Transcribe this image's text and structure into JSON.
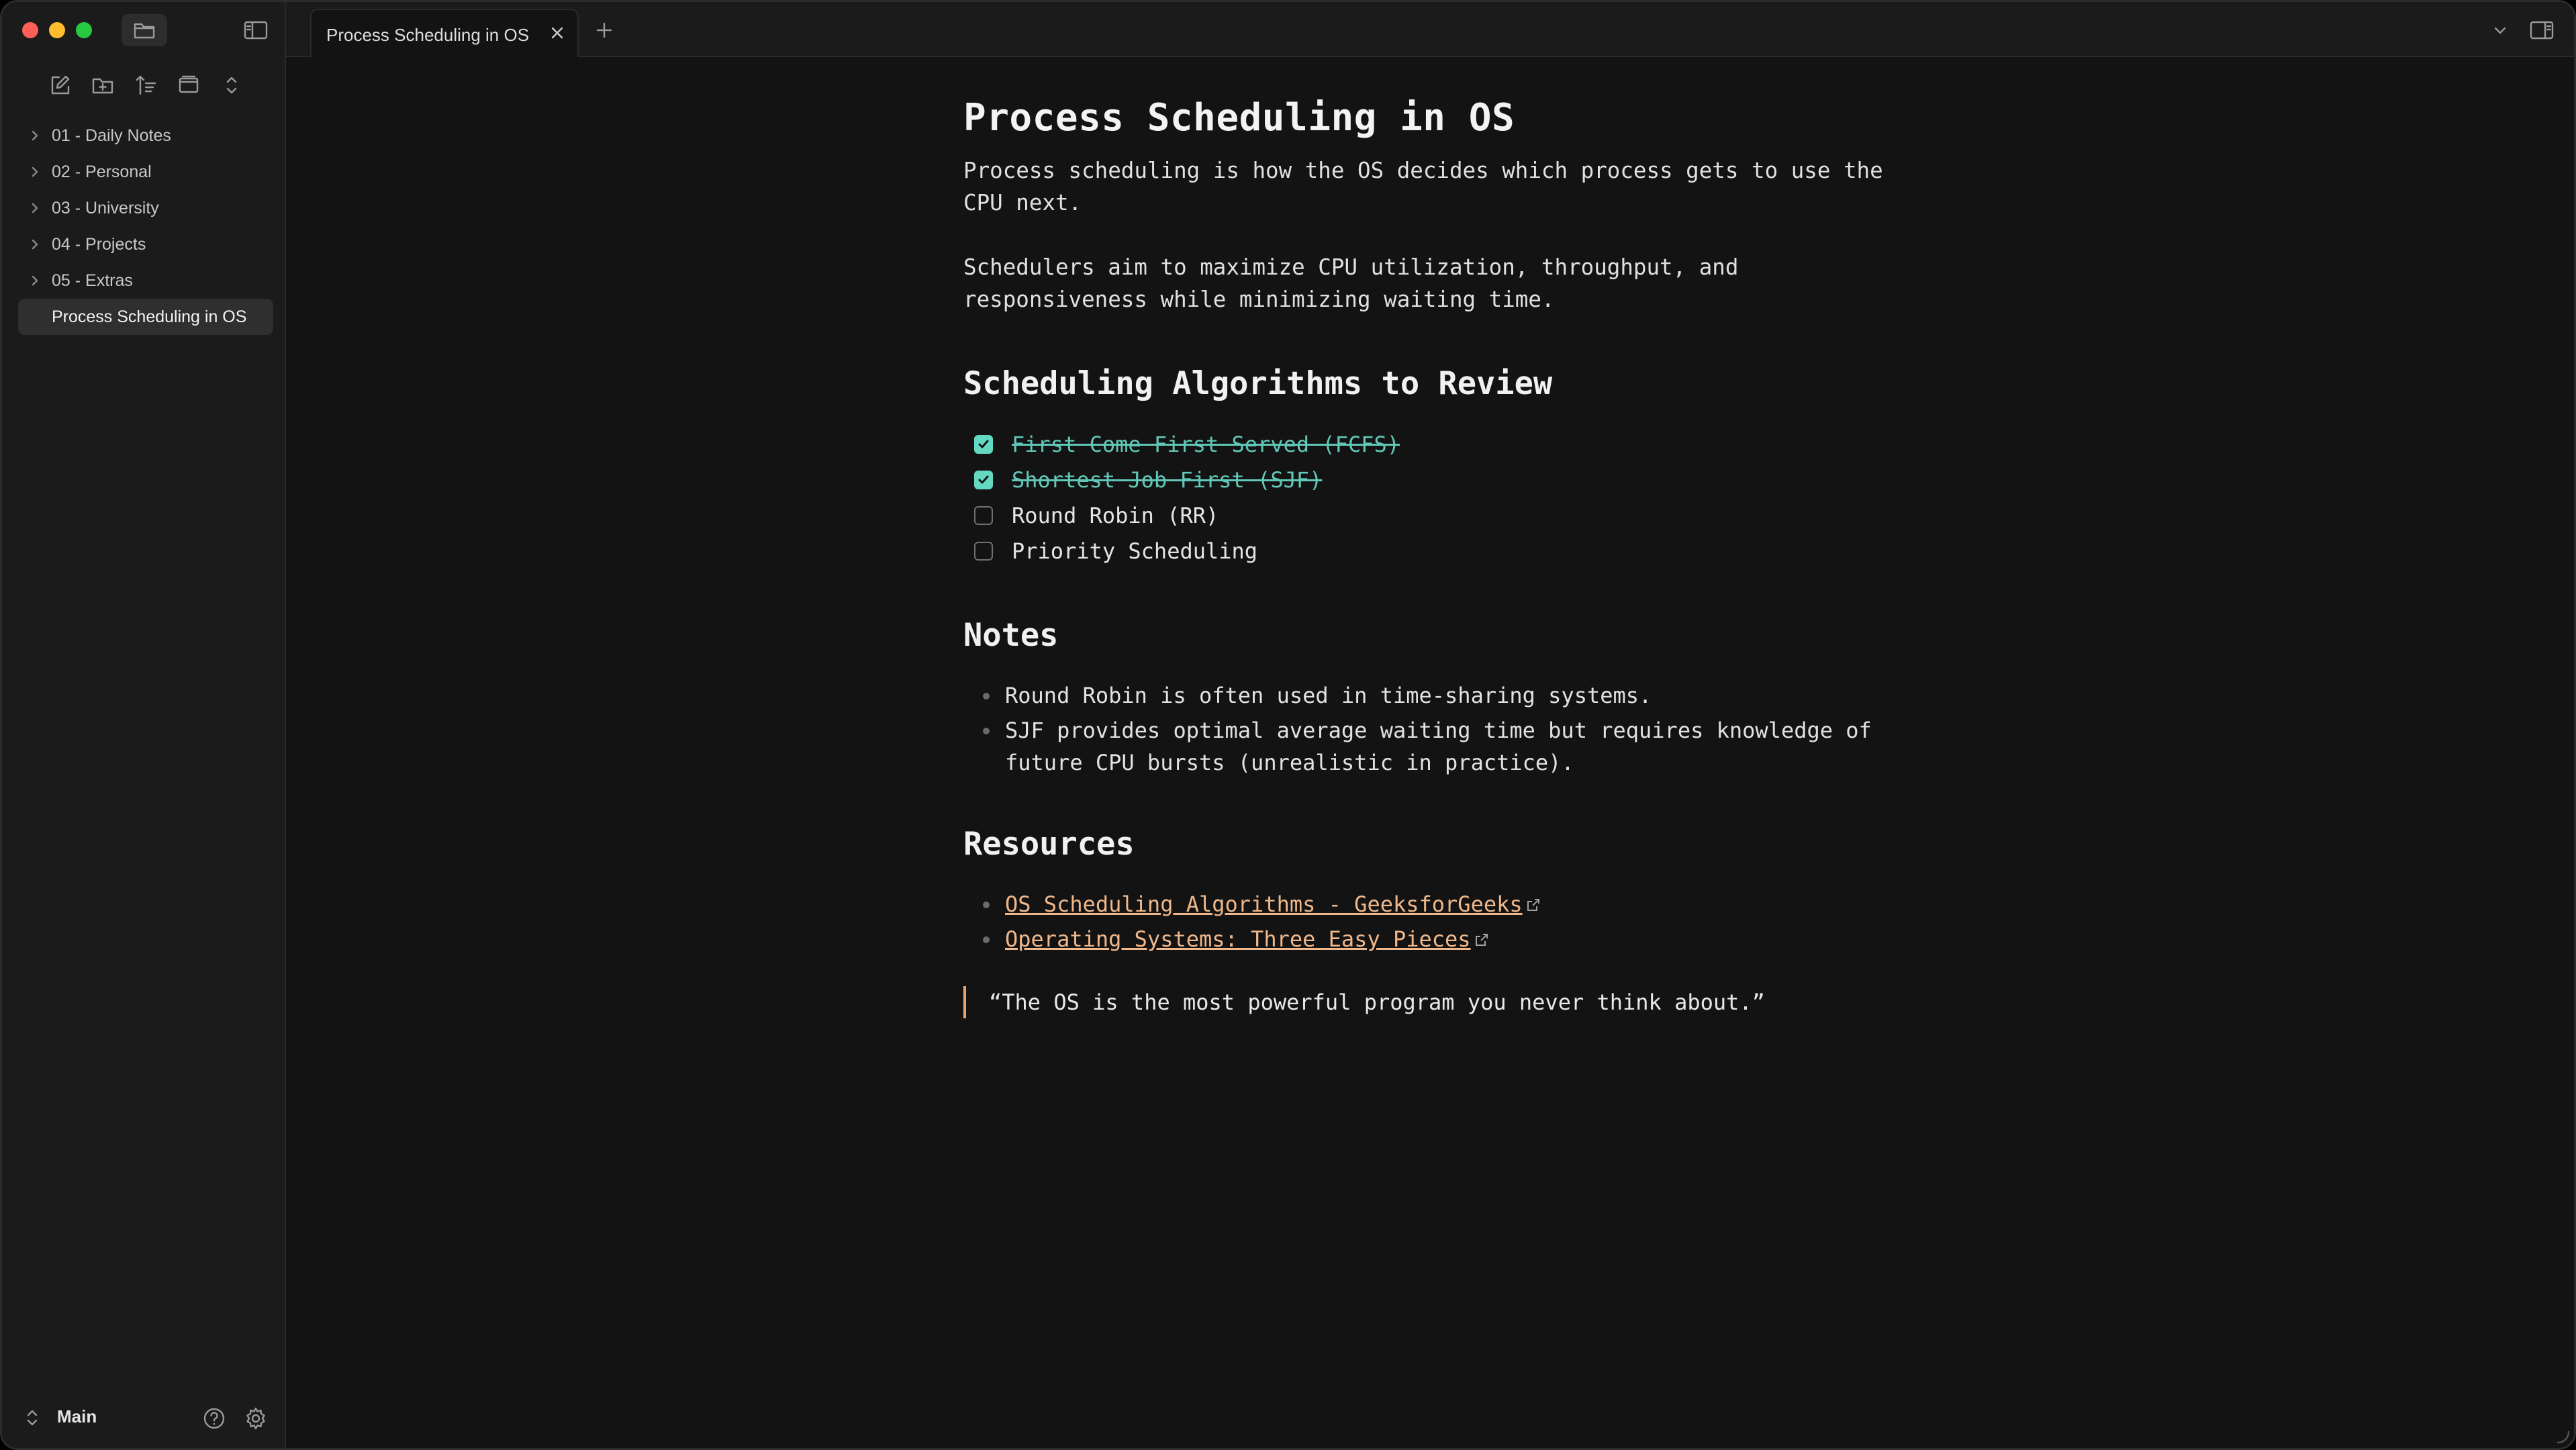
{
  "sidebar": {
    "tree": [
      {
        "label": "01 - Daily Notes",
        "type": "folder"
      },
      {
        "label": "02 - Personal",
        "type": "folder"
      },
      {
        "label": "03 - University",
        "type": "folder"
      },
      {
        "label": "04 - Projects",
        "type": "folder"
      },
      {
        "label": "05 - Extras",
        "type": "folder"
      },
      {
        "label": "Process Scheduling in OS",
        "type": "file",
        "active": true
      }
    ],
    "vault_name": "Main"
  },
  "tabs": [
    {
      "title": "Process Scheduling in OS",
      "active": true
    }
  ],
  "note": {
    "title": "Process Scheduling in OS",
    "intro": [
      "Process scheduling is how the OS decides which process gets to use the CPU next.",
      "Schedulers aim to maximize CPU utilization, throughput, and responsiveness while minimizing waiting time."
    ],
    "algorithms_heading": "Scheduling Algorithms to Review",
    "tasks": [
      {
        "text": "First Come First Served (FCFS)",
        "checked": true
      },
      {
        "text": "Shortest Job First (SJF)",
        "checked": true
      },
      {
        "text": "Round Robin (RR)",
        "checked": false
      },
      {
        "text": "Priority Scheduling",
        "checked": false
      }
    ],
    "notes_heading": "Notes",
    "notes": [
      "Round Robin is often used in time-sharing systems.",
      "SJF provides optimal average waiting time but requires knowledge of future CPU bursts (unrealistic in practice)."
    ],
    "resources_heading": "Resources",
    "resources": [
      "OS Scheduling Algorithms - GeeksforGeeks",
      "Operating Systems: Three Easy Pieces"
    ],
    "quote": "“The OS is the most powerful program you never think about.”"
  },
  "colors": {
    "accent_link": "#f0b88a",
    "task_done": "#65d8c2",
    "quote_bar": "#e8a46b"
  }
}
